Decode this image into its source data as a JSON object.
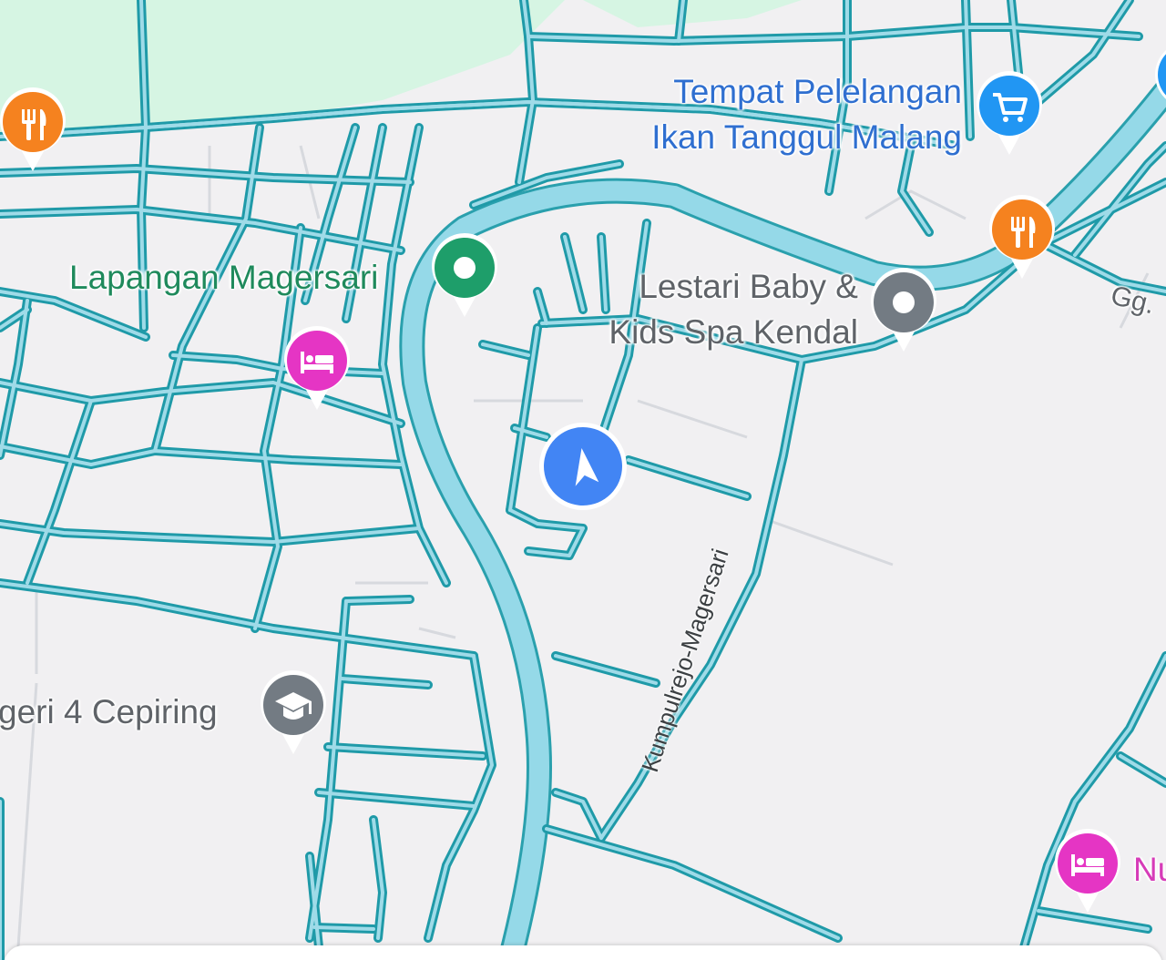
{
  "map": {
    "colors": {
      "background": "#f1f0f2",
      "park": "#d6f5e3",
      "road_fill": "#9fdbe8",
      "road_outline": "#1f9aa8",
      "river": "#95d9e8"
    },
    "places": [
      {
        "id": "tempat",
        "lines": [
          "Tempat Pelelangan",
          "Ikan Tanggul Malang"
        ],
        "category": "shopping",
        "icon": "cart-icon",
        "color": "#2196f3"
      },
      {
        "id": "lapangan",
        "lines": [
          "Lapangan Magersari"
        ],
        "category": "park",
        "icon": "park-icon",
        "color": "#1e9e6a"
      },
      {
        "id": "lestari",
        "lines": [
          "Lestari Baby &",
          "Kids Spa Kendal"
        ],
        "category": "generic",
        "icon": "place-icon",
        "color": "#737b83"
      },
      {
        "id": "sekolah",
        "lines": [
          "geri 4 Cepiring"
        ],
        "category": "school",
        "icon": "school-icon",
        "color": "#737b83"
      },
      {
        "id": "nu",
        "lines": [
          "Nu"
        ],
        "category": "hotel",
        "icon": "bed-icon",
        "color": "#e535c4"
      }
    ],
    "extra_pins": [
      {
        "id": "restaurant-left",
        "icon": "restaurant-icon",
        "color": "#f5821f"
      },
      {
        "id": "restaurant-right",
        "icon": "restaurant-icon",
        "color": "#f5821f"
      },
      {
        "id": "hotel-center",
        "icon": "bed-icon",
        "color": "#e535c4"
      }
    ],
    "roads": [
      {
        "id": "kumpulrejo",
        "label": "Kumpulrejo-Magersari"
      },
      {
        "id": "gg",
        "label": "Gg."
      }
    ],
    "current_location": {
      "icon": "navigation-arrow-icon",
      "color": "#4285f4"
    }
  }
}
